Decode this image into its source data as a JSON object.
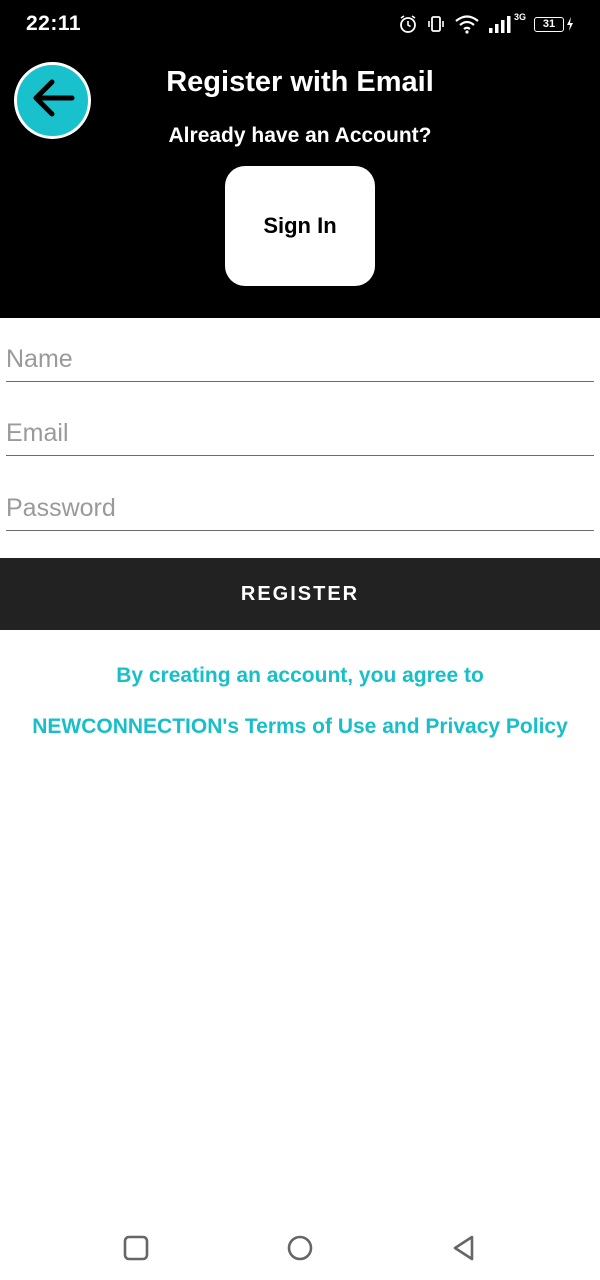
{
  "status_bar": {
    "time": "22:11",
    "network_label": "3G",
    "battery_level": "31",
    "icons": [
      "alarm-icon",
      "vibrate-icon",
      "wifi-icon",
      "signal-icon",
      "battery-icon",
      "charging-icon"
    ]
  },
  "header": {
    "title": "Register with Email",
    "subtitle": "Already have an Account?",
    "sign_in_label": "Sign In",
    "back_icon": "arrow-left-icon"
  },
  "form": {
    "name_placeholder": "Name",
    "email_placeholder": "Email",
    "password_placeholder": "Password",
    "name_value": "",
    "email_value": "",
    "password_value": ""
  },
  "register_label": "REGISTER",
  "terms": {
    "line1": "By creating an account, you agree to",
    "line2": "NEWCONNECTION's Terms of Use and Privacy Policy"
  },
  "nav_bar": {
    "icons": [
      "recent-apps-icon",
      "home-icon",
      "back-icon"
    ]
  },
  "colors": {
    "accent": "#18c1cc",
    "header_bg": "#000000",
    "register_bg": "#222222",
    "terms_text": "#18bfc9"
  }
}
